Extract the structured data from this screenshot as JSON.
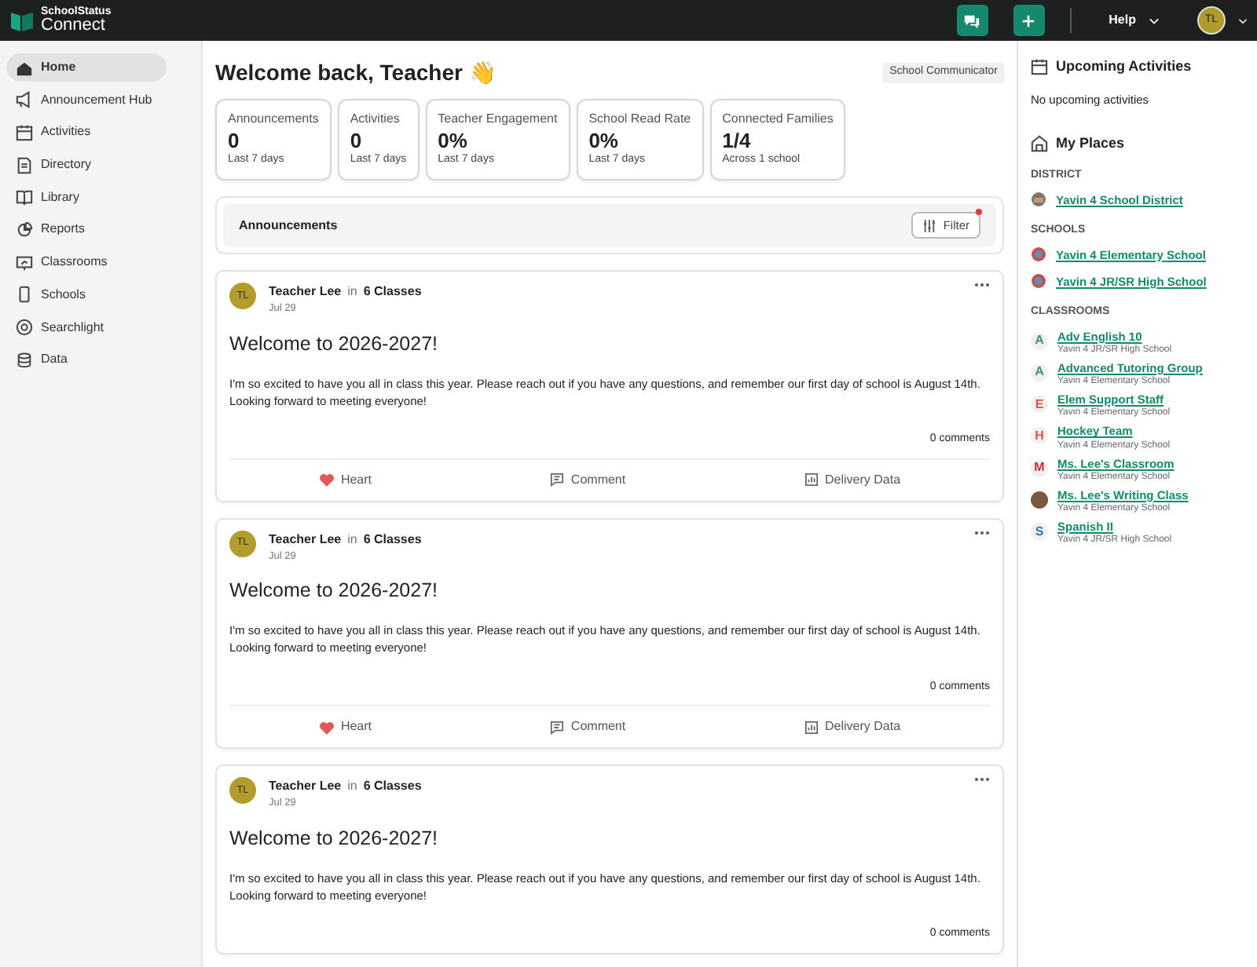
{
  "topbar": {
    "brand_top": "SchoolStatus",
    "brand_bottom": "Connect",
    "help": "Help",
    "avatar": "TL"
  },
  "sidebar": {
    "items": [
      {
        "label": "Home",
        "selected": true
      },
      {
        "label": "Announcement Hub",
        "selected": false
      },
      {
        "label": "Activities",
        "selected": false
      },
      {
        "label": "Directory",
        "selected": false
      },
      {
        "label": "Library",
        "selected": false
      },
      {
        "label": "Reports",
        "selected": false
      },
      {
        "label": "Classrooms",
        "selected": false
      },
      {
        "label": "Schools",
        "selected": false
      },
      {
        "label": "Searchlight",
        "selected": false
      },
      {
        "label": "Data",
        "selected": false
      }
    ]
  },
  "header": {
    "title": "Welcome back, Teacher 👋",
    "role": "School Communicator"
  },
  "stats": [
    {
      "label": "Announcements",
      "value": "0",
      "note": "Last 7 days"
    },
    {
      "label": "Activities",
      "value": "0",
      "note": "Last 7 days"
    },
    {
      "label": "Teacher Engagement",
      "value": "0%",
      "note": "Last 7 days"
    },
    {
      "label": "School Read Rate",
      "value": "0%",
      "note": "Last 7 days"
    },
    {
      "label": "Connected Families",
      "value": "1/4",
      "note": "Across 1 school"
    }
  ],
  "announcements_bar": {
    "title": "Announcements",
    "filter": "Filter",
    "filter_active": true
  },
  "posts": [
    {
      "avatar": "TL",
      "author": "Teacher Lee",
      "in": "in",
      "audience": "6 Classes",
      "date": "Jul 29",
      "title": "Welcome to 2026-2027!",
      "body": "I'm so excited to have you all in class this year. Please reach out if you have any questions, and remember our first day of school is August 14th. Looking forward to meeting everyone!",
      "comments": "0 comments",
      "actions": [
        "Heart",
        "Comment",
        "Delivery Data"
      ]
    },
    {
      "avatar": "TL",
      "author": "Teacher Lee",
      "in": "in",
      "audience": "6 Classes",
      "date": "Jul 29",
      "title": "Welcome to 2026-2027!",
      "body": "I'm so excited to have you all in class this year. Please reach out if you have any questions, and remember our first day of school is August 14th. Looking forward to meeting everyone!",
      "comments": "0 comments",
      "actions": [
        "Heart",
        "Comment",
        "Delivery Data"
      ]
    },
    {
      "avatar": "TL",
      "author": "Teacher Lee",
      "in": "in",
      "audience": "6 Classes",
      "date": "Jul 29",
      "title": "Welcome to 2026-2027!",
      "body": "I'm so excited to have you all in class this year. Please reach out if you have any questions, and remember our first day of school is August 14th. Looking forward to meeting everyone!",
      "comments": "0 comments"
    }
  ],
  "right_panel": {
    "upcoming_title": "Upcoming Activities",
    "upcoming_empty": "No upcoming activities",
    "places_title": "My Places",
    "district_heading": "DISTRICT",
    "districts": [
      "Yavin 4 School District"
    ],
    "schools_heading": "SCHOOLS",
    "schools": [
      "Yavin 4 Elementary School",
      "Yavin 4 JR/SR High School"
    ],
    "classrooms_heading": "CLASSROOMS",
    "classrooms": [
      {
        "kind": "letter",
        "letter": "A",
        "color": "#3a9a5b",
        "name": "Adv English 10",
        "school": "Yavin 4 JR/SR High School"
      },
      {
        "kind": "letter",
        "letter": "A",
        "color": "#3a9a5b",
        "name": "Advanced Tutoring Group",
        "school": "Yavin 4 Elementary School"
      },
      {
        "kind": "letter",
        "letter": "E",
        "color": "#d9534f",
        "name": "Elem Support Staff",
        "school": "Yavin 4 Elementary School"
      },
      {
        "kind": "letter",
        "letter": "H",
        "color": "#d9534f",
        "name": "Hockey Team",
        "school": "Yavin 4 Elementary School"
      },
      {
        "kind": "letter",
        "letter": "M",
        "color": "#c9302c",
        "name": "Ms. Lee's Classroom",
        "school": "Yavin 4 Elementary School"
      },
      {
        "kind": "photo",
        "name": "Ms. Lee's Writing Class",
        "school": "Yavin 4 Elementary School"
      },
      {
        "kind": "letter",
        "letter": "S",
        "color": "#2b7bbf",
        "name": "Spanish II",
        "school": "Yavin 4 JR/SR High School"
      }
    ]
  }
}
